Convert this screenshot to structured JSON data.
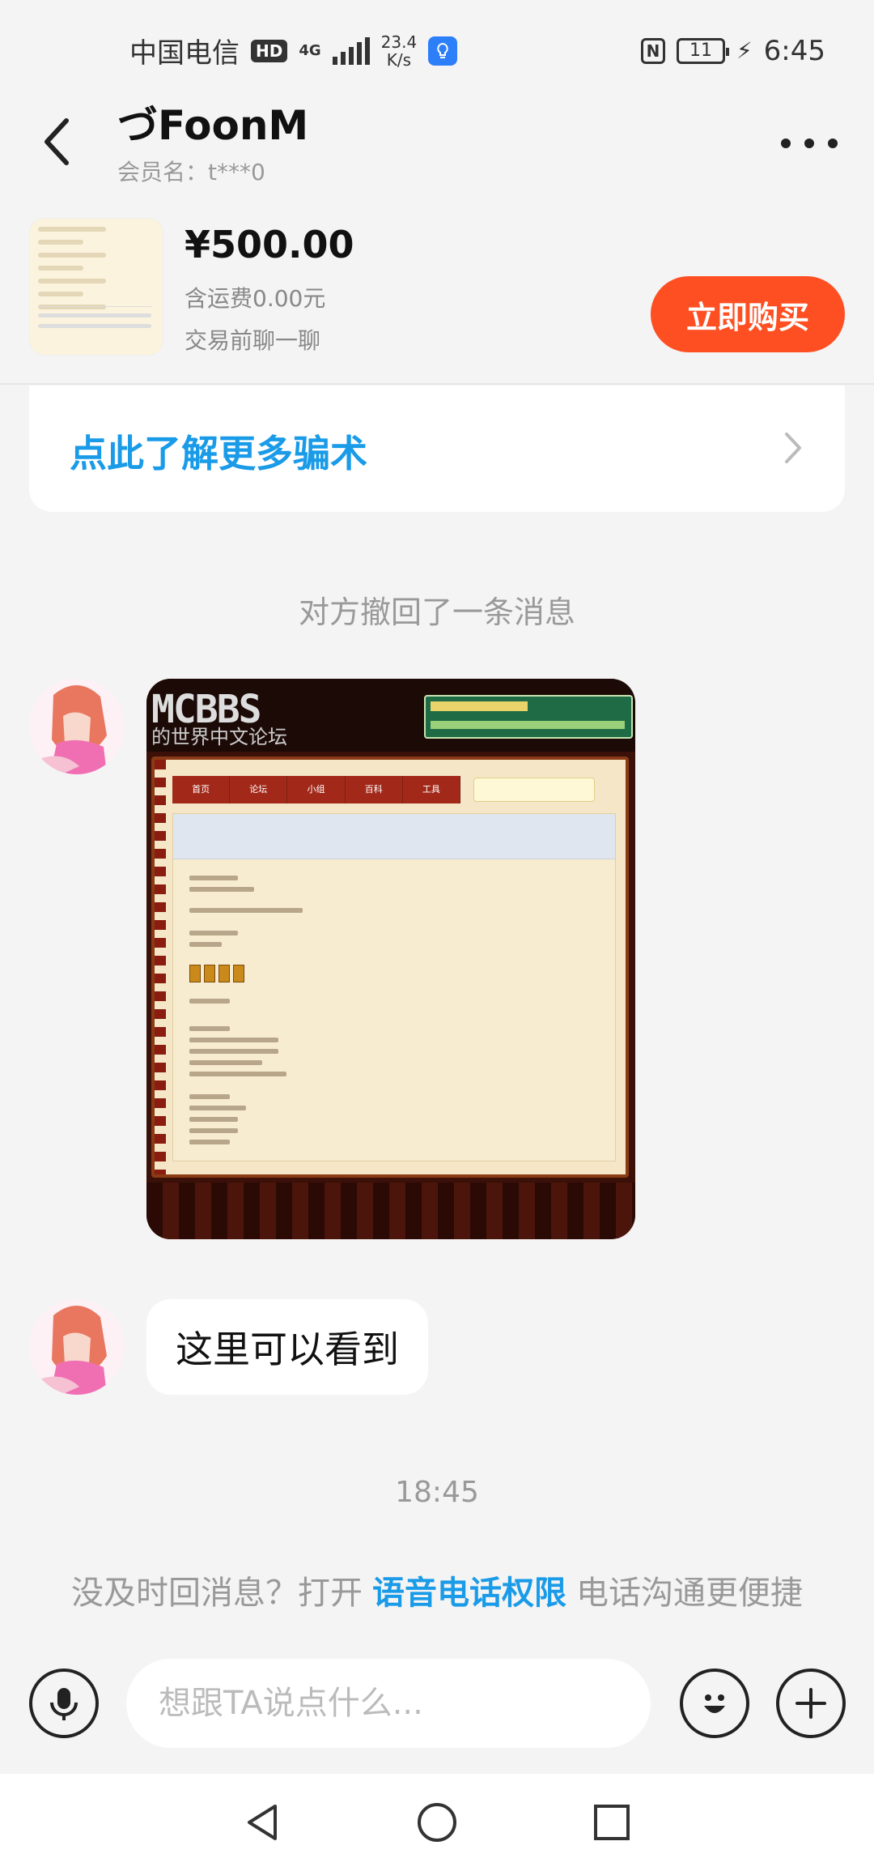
{
  "status_bar": {
    "carrier": "中国电信",
    "hd": "HD",
    "network": "4G",
    "speed_value": "23.4",
    "speed_unit": "K/s",
    "nfc": "N",
    "battery": "11",
    "time": "6:45"
  },
  "header": {
    "title": "づFoonM",
    "member": "会员名：t***0"
  },
  "product": {
    "price": "¥500.00",
    "shipping": "含运费0.00元",
    "chat_first": "交易前聊一聊",
    "buy_label": "立即购买"
  },
  "notice": {
    "fraud_link": "点此了解更多骗术"
  },
  "messages": {
    "recall": "对方撤回了一条消息",
    "image_logo": "MCBBS",
    "image_logo_sub": "的世界中文论坛",
    "image_nav": [
      "首页",
      "论坛",
      "小组",
      "百科",
      "工具"
    ],
    "text": "这里可以看到",
    "time": "18:45"
  },
  "voice_tip": {
    "before": "没及时回消息？打开",
    "link": "语音电话权限",
    "after": "电话沟通更便捷"
  },
  "input": {
    "placeholder": "想跟TA说点什么..."
  },
  "icons": [
    "back-icon",
    "more-icon",
    "chevron-right-icon",
    "mic-icon",
    "emoji-icon",
    "plus-icon",
    "nav-back-icon",
    "nav-home-icon",
    "nav-recents-icon"
  ],
  "colors": {
    "accent_orange": "#fe4f22",
    "link_blue": "#1a9be8",
    "background": "#f4f4f4"
  }
}
